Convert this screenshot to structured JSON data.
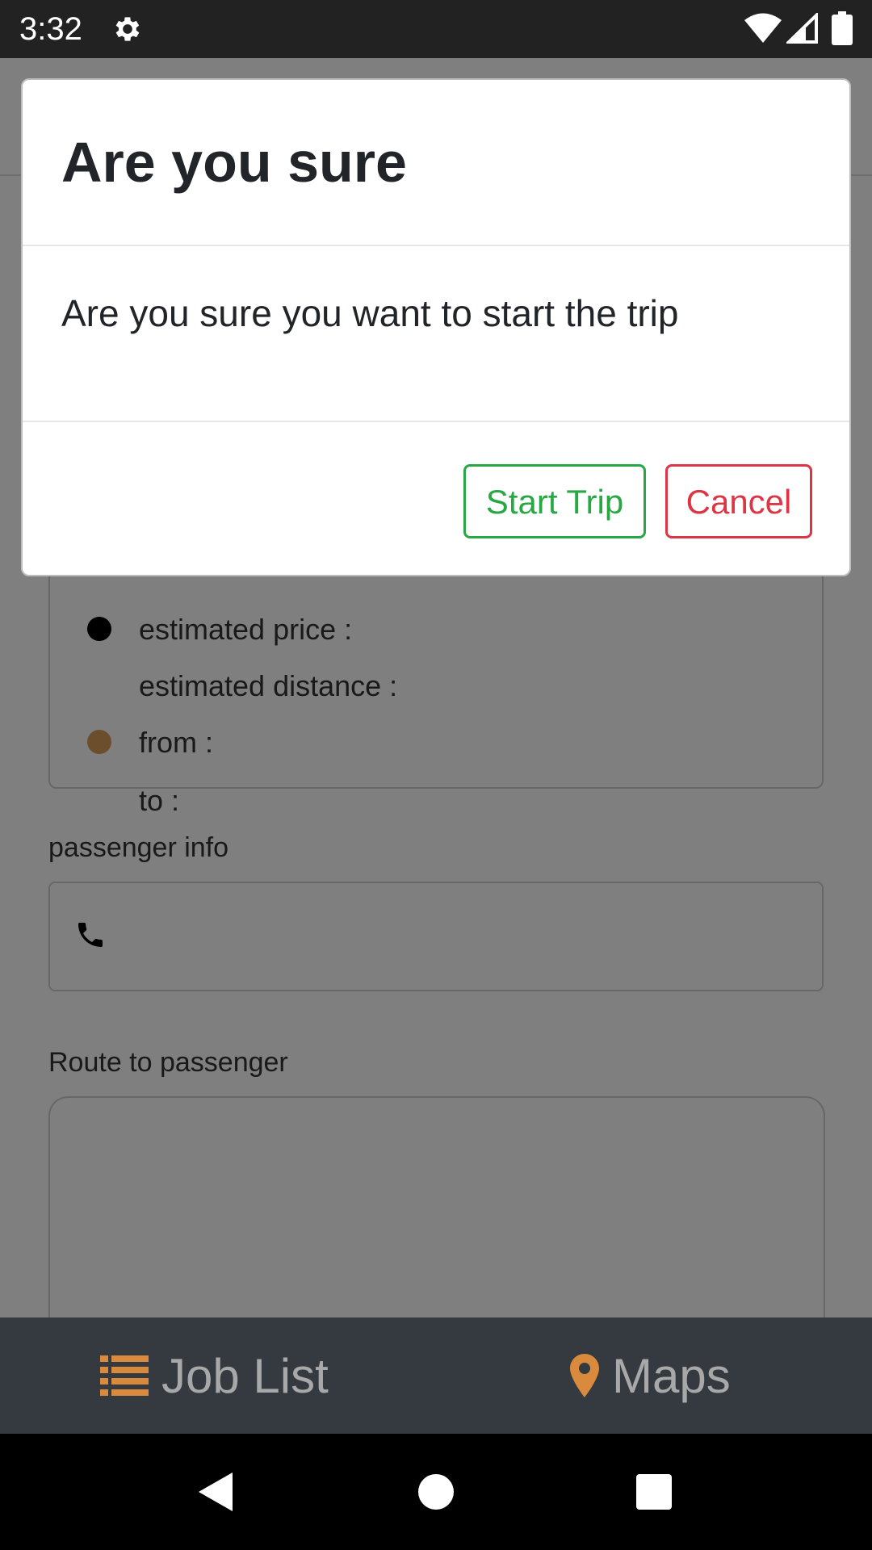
{
  "status_bar": {
    "time": "3:32"
  },
  "trip_card": {
    "estimated_price_label": "estimated price :",
    "estimated_distance_label": "estimated distance :",
    "from_label": "from :",
    "to_label": "to :"
  },
  "passenger": {
    "section_label": "passenger info"
  },
  "route": {
    "section_label": "Route to passenger"
  },
  "bottom_nav": {
    "job_list_label": "Job List",
    "maps_label": "Maps",
    "accent_color": "#d98a3c"
  },
  "dialog": {
    "title": "Are you sure",
    "message": "Are you sure you want to start the trip",
    "start_label": "Start Trip",
    "cancel_label": "Cancel",
    "start_color": "#28a745",
    "cancel_color": "#dc3545"
  },
  "icons": [
    "gear-icon",
    "wifi-icon",
    "signal-icon",
    "battery-icon",
    "phone-icon",
    "list-icon",
    "map-pin-icon",
    "back-icon",
    "home-icon",
    "recents-icon"
  ]
}
